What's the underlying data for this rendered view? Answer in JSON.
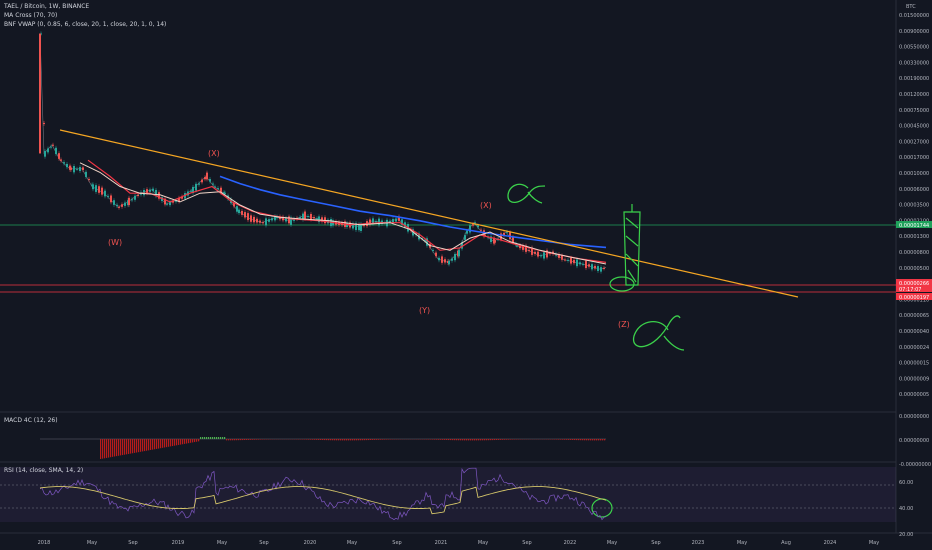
{
  "legend": {
    "symbol": "TAEL / Bitcoin, 1W, BINANCE",
    "ma_cross": "MA Cross (70, 70)",
    "vwap": "BNF VWAP (0, 0.85, 6, close, 20, 1, close, 20, 1, 0, 14)",
    "macd": "MACD 4C (12, 26)",
    "rsi": "RSI (14, close, SMA, 14, 2)"
  },
  "price_axis": {
    "currency": "BTC",
    "labels": [
      "0.01500000",
      "0.00900000",
      "0.00550000",
      "0.00330000",
      "0.00190000",
      "0.00120000",
      "0.00075000",
      "0.00045000",
      "0.00027000",
      "0.00017000",
      "0.00010000",
      "0.00006000",
      "0.00003500",
      "0.00002100",
      "0.00001300",
      "0.00000800",
      "0.00000500",
      "0.00000300",
      "0.00000110",
      "0.00000065",
      "0.00000040",
      "0.00000024",
      "0.00000015",
      "0.00000009",
      "0.00000005"
    ],
    "tags": [
      {
        "text": "0.00001744",
        "color": "#1fa15b"
      },
      {
        "text": "0.00000266",
        "color": "#f23645"
      },
      {
        "text": "07:17:07",
        "color": "#f23645"
      },
      {
        "text": "0.00000197",
        "color": "#f23645"
      }
    ]
  },
  "macd_axis": {
    "labels": [
      "0.00000000",
      "-0.00000000"
    ]
  },
  "rsi_axis": {
    "labels": [
      "60.00",
      "40.00",
      "20.00"
    ]
  },
  "time_axis": {
    "labels": [
      "2018",
      "May",
      "Sep",
      "2019",
      "May",
      "Sep",
      "2020",
      "May",
      "Sep",
      "2021",
      "May",
      "Sep",
      "2022",
      "May",
      "Sep",
      "2023",
      "May",
      "Aug",
      "2024",
      "May"
    ]
  },
  "wave_labels": [
    "(W)",
    "(X)",
    "(Y)",
    "(X)",
    "(Y)",
    "(Z)"
  ],
  "colors": {
    "background": "#131722",
    "trendline": "#f5a623",
    "ma_blue": "#2962ff",
    "ma_red": "#f23645",
    "ma_white": "#f0d5c8",
    "support_green": "#1fa15b",
    "handwriting": "#3bd14b",
    "rsi_line": "#7e57c2",
    "rsi_ma": "#d4c56a",
    "macd_neg": "#b71c1c",
    "macd_pos": "#4caf50"
  },
  "chart_data": {
    "type": "line",
    "title": "TAEL / Bitcoin, 1W, BINANCE",
    "y_scale": "log",
    "x": [
      "2018",
      "May",
      "Sep",
      "2019",
      "May",
      "Sep",
      "2020",
      "May",
      "Sep",
      "2021",
      "May",
      "Sep",
      "2022"
    ],
    "series": [
      {
        "name": "close",
        "values": [
          0.00015,
          7e-05,
          2.5e-05,
          7e-05,
          4.5e-05,
          1.8e-05,
          1.6e-05,
          1.5e-05,
          1.1e-05,
          4e-06,
          1.3e-05,
          6e-06,
          3.5e-06
        ]
      },
      {
        "name": "MA",
        "values": [
          0.00015,
          0.0001,
          5e-05,
          4e-05,
          4e-05,
          3e-05,
          2.5e-05,
          2e-05,
          1.4e-05,
          1.1e-05,
          9e-06,
          7e-06,
          5e-06
        ]
      }
    ],
    "trendline": {
      "from": [
        "2018",
        0.0003
      ],
      "to": [
        "Aug 2023",
        1.7e-06
      ]
    },
    "support_levels": [
      1.744e-05,
      2.66e-06,
      1.97e-06
    ],
    "macd": {
      "min": -0.0,
      "max": 0.0
    },
    "rsi": {
      "levels": [
        60,
        40,
        20
      ]
    }
  }
}
